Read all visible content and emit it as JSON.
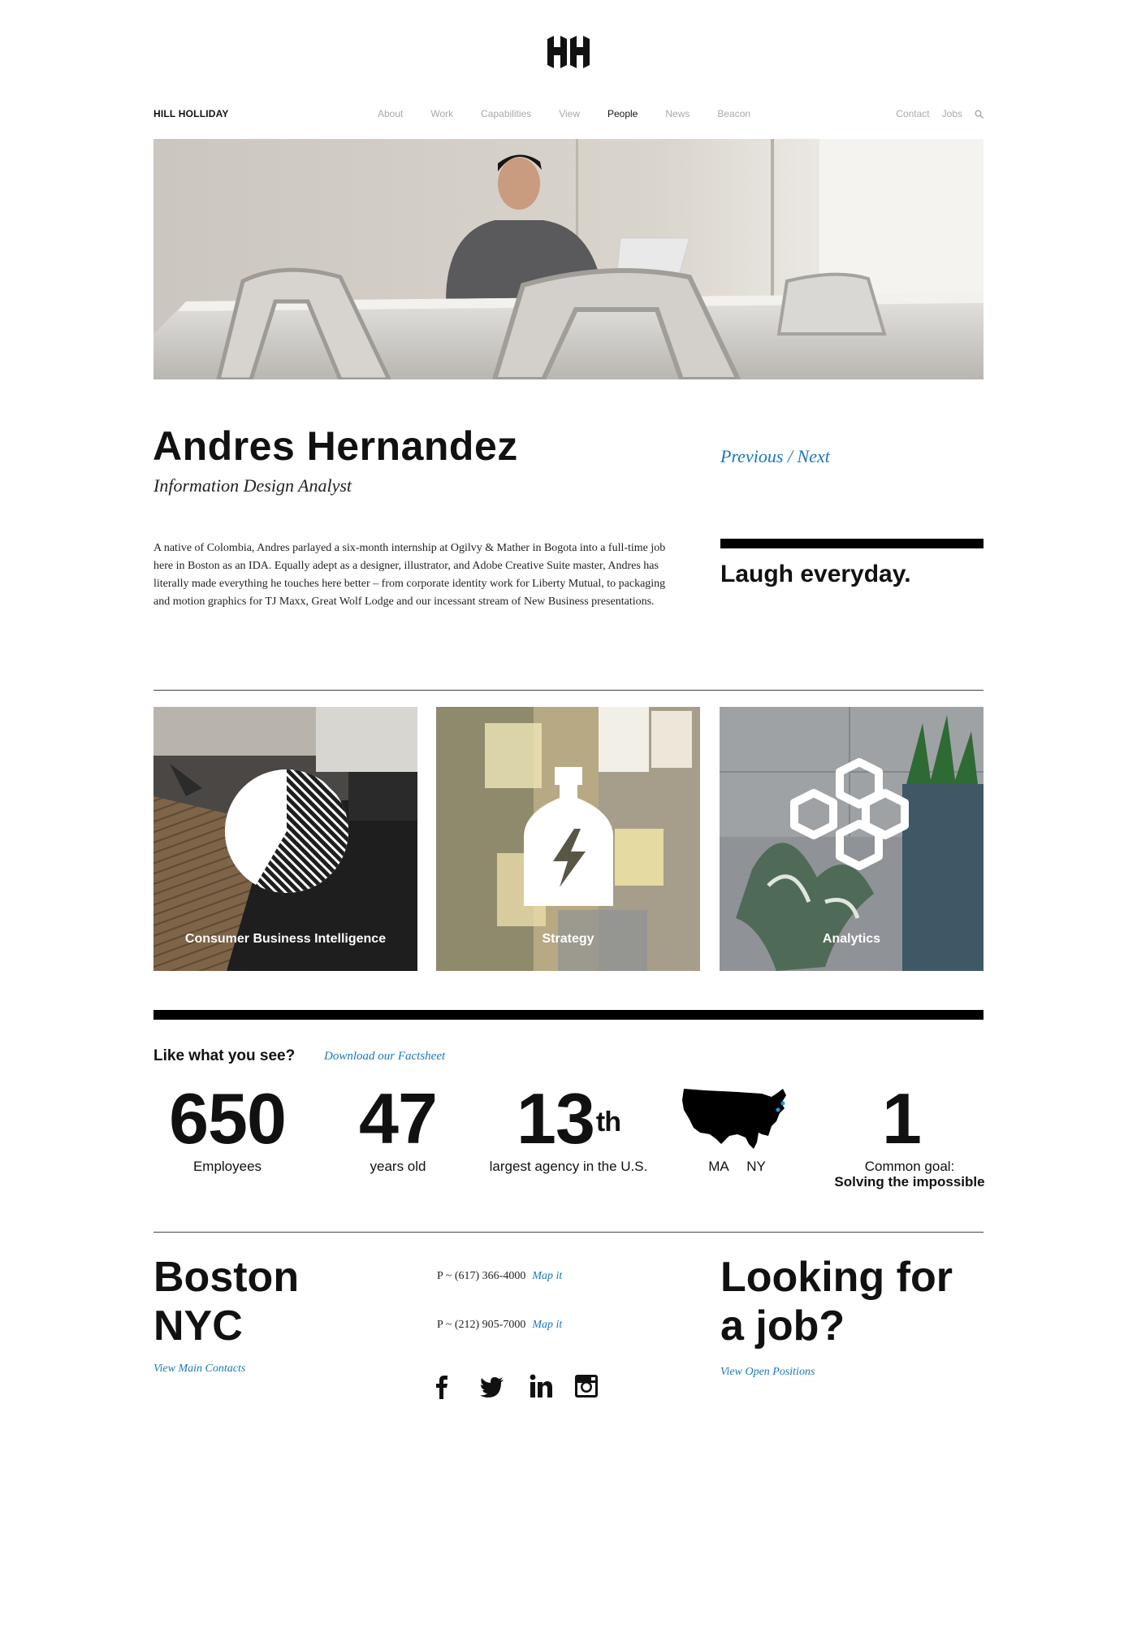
{
  "brand": "HILL HOLLIDAY",
  "nav": {
    "main": [
      {
        "label": "About",
        "active": false
      },
      {
        "label": "Work",
        "active": false
      },
      {
        "label": "Capabilities",
        "active": false
      },
      {
        "label": "View",
        "active": false
      },
      {
        "label": "People",
        "active": true
      },
      {
        "label": "News",
        "active": false
      },
      {
        "label": "Beacon",
        "active": false
      }
    ],
    "contact": "Contact",
    "jobs": "Jobs"
  },
  "profile": {
    "name": "Andres Hernandez",
    "title": "Information Design Analyst",
    "previous": "Previous",
    "separator": " / ",
    "next": "Next",
    "bio": "A native of Colombia, Andres parlayed a six-month internship at Ogilvy & Mather in Bogota into a full-time job here in Boston as an IDA. Equally adept as a designer, illustrator, and Adobe Creative Suite master, Andres has literally made everything he touches here better – from corporate identity work for Liberty Mutual, to packaging and motion graphics for TJ Maxx, Great Wolf Lodge and our incessant stream of New Business presentations.",
    "quote": "Laugh everyday."
  },
  "capabilities": [
    {
      "label": "Consumer Business Intelligence",
      "icon": "pie-chart-icon"
    },
    {
      "label": "Strategy",
      "icon": "bottle-icon"
    },
    {
      "label": "Analytics",
      "icon": "honeycomb-icon"
    }
  ],
  "facts": {
    "heading": "Like what you see?",
    "download": "Download our Factsheet",
    "employees": {
      "value": "650",
      "label": "Employees"
    },
    "age": {
      "value": "47",
      "label": "years old"
    },
    "rank": {
      "value": "13",
      "suffix": "th",
      "label": "largest agency in the U.S."
    },
    "map": {
      "icon": "us-map-icon",
      "ma": "MA",
      "ny": "NY"
    },
    "goal": {
      "value": "1",
      "label": "Common goal:",
      "sublabel": "Solving the impossible"
    }
  },
  "contact": {
    "city1": "Boston",
    "city2": "NYC",
    "main_contacts": "View Main Contacts",
    "phone1": "P ~ (617) 366-4000",
    "phone2": "P ~ (212) 905-7000",
    "map_it": "Map it",
    "jobs_line1": "Looking for",
    "jobs_line2": "a job?",
    "open_positions": "View Open Positions"
  },
  "colors": {
    "accent": "#1a78b8",
    "text": "#111111",
    "nav_inactive": "#a9a9a9"
  }
}
